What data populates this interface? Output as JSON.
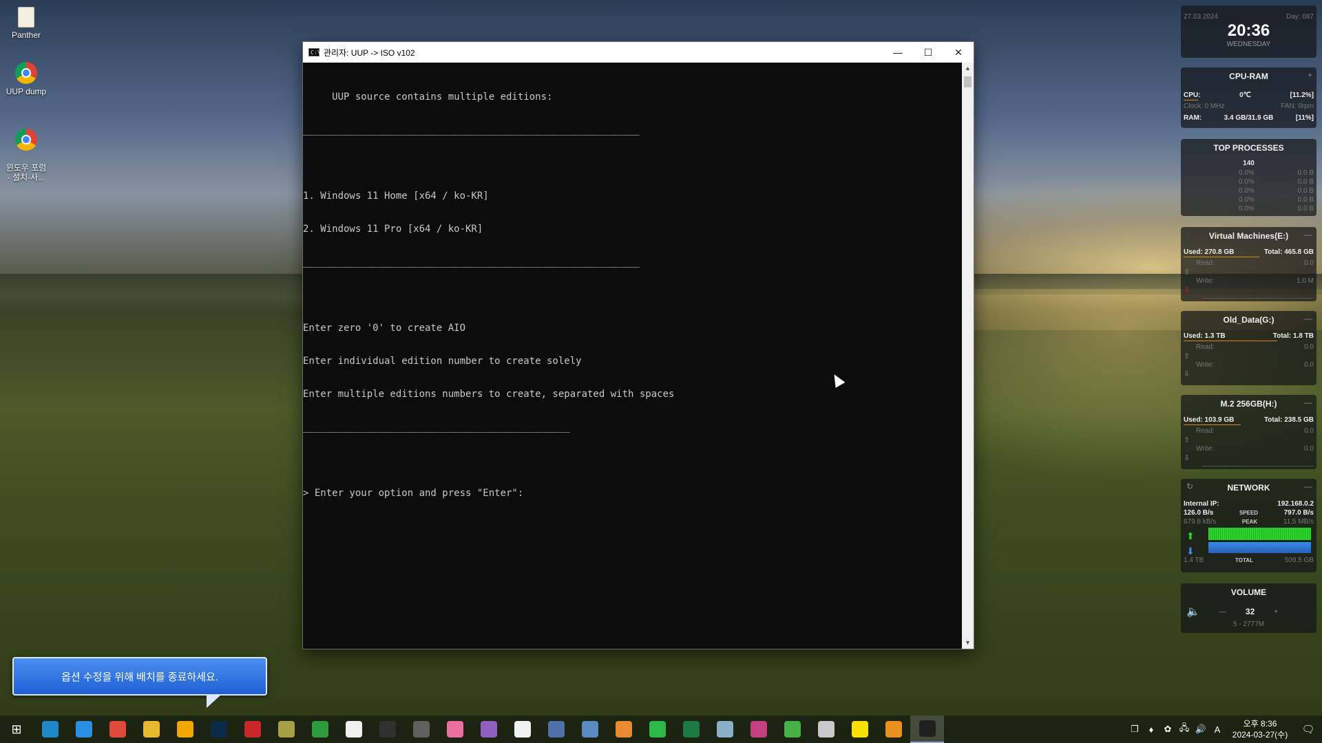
{
  "desktop": {
    "icons": [
      {
        "label": "Panther"
      },
      {
        "label": "UUP dump"
      },
      {
        "label": "윈도우 포럼\n- 설치-사..."
      }
    ]
  },
  "console": {
    "title": "관리자:  UUP -> ISO v102",
    "lines": [
      "     UUP source contains multiple editions:",
      "__________________________________________________________",
      "",
      "1. Windows 11 Home [x64 / ko-KR]",
      "2. Windows 11 Pro [x64 / ko-KR]",
      "__________________________________________________________",
      "",
      "Enter zero '0' to create AIO",
      "Enter individual edition number to create solely",
      "Enter multiple editions numbers to create, separated with spaces",
      "______________________________________________",
      "",
      "> Enter your option and press \"Enter\":"
    ]
  },
  "balloon": {
    "text": "옵션 수정을 위해 배치를 종료하세요."
  },
  "widgets": {
    "datetime": {
      "date": "27.03.2024",
      "day": "Day: 087",
      "time": "20:36",
      "weekday": "WEDNESDAY"
    },
    "cpu_ram": {
      "title": "CPU-RAM",
      "cpu_label": "CPU:",
      "cpu_value": "0℃",
      "cpu_pct": "[11.2%]",
      "clock": "Clock: 0 MHz",
      "fan": "FAN: 0rpm",
      "ram_label": "RAM:",
      "ram_value": "3.4 GB/31.9 GB",
      "ram_pct": "[11%]"
    },
    "top_processes": {
      "title": "TOP PROCESSES",
      "count": "140",
      "rows": [
        {
          "cpu": "0.0%",
          "mem": "0.0 B"
        },
        {
          "cpu": "0.0%",
          "mem": "0.0 B"
        },
        {
          "cpu": "0.0%",
          "mem": "0.0 B"
        },
        {
          "cpu": "0.0%",
          "mem": "0.0 B"
        },
        {
          "cpu": "0.0%",
          "mem": "0.0 B"
        }
      ]
    },
    "disks": [
      {
        "title": "Virtual Machines(E:)",
        "used": "Used: 270.8 GB",
        "total": "Total: 465.8 GB",
        "read": "Read:",
        "read_v": "0.0",
        "write": "Write:",
        "write_v": "1.0 M"
      },
      {
        "title": "Old_Data(G:)",
        "used": "Used: 1.3 TB",
        "total": "Total: 1.8 TB",
        "read": "Read:",
        "read_v": "0.0",
        "write": "Write:",
        "write_v": "0.0"
      },
      {
        "title": "M.2 256GB(H:)",
        "used": "Used: 103.9 GB",
        "total": "Total: 238.5 GB",
        "read": "Read:",
        "read_v": "0.0",
        "write": "Write:",
        "write_v": "0.0"
      }
    ],
    "network": {
      "title": "NETWORK",
      "ip_label": "Internal IP:",
      "ip": "192.168.0.2",
      "up": "126.0 B/s",
      "speed_label": "SPEED",
      "speed": "797.0 B/s",
      "down": "679.8 kB/s",
      "peak_label": "PEAK",
      "peak": "11.5 MB/s",
      "total_up": "1.4 TB",
      "total_label": "TOTAL",
      "total_down": "509.5 GB"
    },
    "volume": {
      "title": "VOLUME",
      "minus": "—",
      "value": "32",
      "plus": "+",
      "track": "5 - 2777M"
    }
  },
  "taskbar": {
    "apps": [
      {
        "name": "edge",
        "color": "#1e88c8"
      },
      {
        "name": "ie",
        "color": "#2a8fe0"
      },
      {
        "name": "chrome",
        "color": "#e04a3a"
      },
      {
        "name": "explorer",
        "color": "#e8b830"
      },
      {
        "name": "app5",
        "color": "#f2a600"
      },
      {
        "name": "photoshop",
        "color": "#0b2a48"
      },
      {
        "name": "app7",
        "color": "#c8282a"
      },
      {
        "name": "app8",
        "color": "#a8a048"
      },
      {
        "name": "app9",
        "color": "#2e9a3e"
      },
      {
        "name": "app10",
        "color": "#f0f0f0"
      },
      {
        "name": "app11",
        "color": "#303030"
      },
      {
        "name": "app12",
        "color": "#606060"
      },
      {
        "name": "app13",
        "color": "#e86fa0"
      },
      {
        "name": "app14",
        "color": "#9060c0"
      },
      {
        "name": "app15",
        "color": "#f2f2f2"
      },
      {
        "name": "app16",
        "color": "#5070a8"
      },
      {
        "name": "app17",
        "color": "#5a8ac0"
      },
      {
        "name": "app18",
        "color": "#e88a30"
      },
      {
        "name": "app19",
        "color": "#2eb84a"
      },
      {
        "name": "excel",
        "color": "#1e7a44"
      },
      {
        "name": "app21",
        "color": "#8ab0c8"
      },
      {
        "name": "app22",
        "color": "#c04080"
      },
      {
        "name": "utorrent",
        "color": "#48b048"
      },
      {
        "name": "app24",
        "color": "#c8c8c8"
      },
      {
        "name": "kakaotalk",
        "color": "#f7e000"
      },
      {
        "name": "app26",
        "color": "#e89020"
      },
      {
        "name": "terminal",
        "color": "#202020"
      }
    ],
    "tray": {
      "ime": "A",
      "time": "오후 8:36",
      "date": "2024-03-27(수)"
    }
  }
}
